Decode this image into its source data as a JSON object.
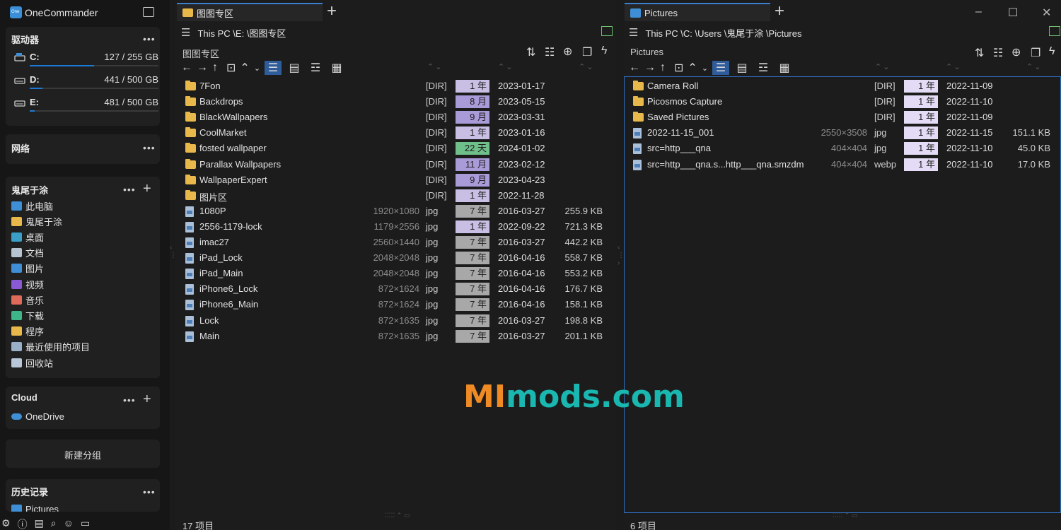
{
  "app": {
    "title": "OneCommander",
    "logo_text": "One"
  },
  "sidebar": {
    "drives_title": "驱动器",
    "drives": [
      {
        "letter": "C:",
        "size": "127 / 255 GB",
        "used_fraction": 0.5
      },
      {
        "letter": "D:",
        "size": "441 / 500 GB",
        "used_fraction": 0.1
      },
      {
        "letter": "E:",
        "size": "481 / 500 GB",
        "used_fraction": 0.04
      }
    ],
    "network_title": "网络",
    "favorites_title": "鬼尾于涂",
    "favorites": [
      {
        "label": "此电脑",
        "icon": "monitor-icon",
        "color": "#3f8fd6"
      },
      {
        "label": "鬼尾于涂",
        "icon": "folder-icon",
        "color": "#e8b94a"
      },
      {
        "label": "桌面",
        "icon": "desktop-icon",
        "color": "#3aa0c8"
      },
      {
        "label": "文档",
        "icon": "document-icon",
        "color": "#b8c4d0"
      },
      {
        "label": "图片",
        "icon": "pictures-icon",
        "color": "#3f8fd6"
      },
      {
        "label": "视频",
        "icon": "video-icon",
        "color": "#8a5ad6"
      },
      {
        "label": "音乐",
        "icon": "music-icon",
        "color": "#e06a5a"
      },
      {
        "label": "下载",
        "icon": "download-icon",
        "color": "#3fb58a"
      },
      {
        "label": "程序",
        "icon": "folder-icon",
        "color": "#e8b94a"
      },
      {
        "label": "最近使用的项目",
        "icon": "recent-icon",
        "color": "#9ab0c8"
      },
      {
        "label": "回收站",
        "icon": "recycle-bin-icon",
        "color": "#b8c8d8"
      }
    ],
    "cloud_title": "Cloud",
    "cloud_items": [
      {
        "label": "OneDrive",
        "icon": "onedrive-icon",
        "color": "#3f8fd6"
      }
    ],
    "new_group_label": "新建分组",
    "history_title": "历史记录",
    "history_items": [
      "Pictures"
    ],
    "more_glyph": "•••",
    "plus_glyph": "+"
  },
  "left_pane": {
    "tab_label": "图图专区",
    "address": "This PC \\E: \\图图专区",
    "label": "图图专区",
    "status": "17 项目",
    "rows": [
      {
        "type": "dir",
        "name": "7Fon",
        "dim": "",
        "ext": "[DIR]",
        "age": "1 年",
        "age_color": "#c9bfe4",
        "date": "2023-01-17",
        "size": ""
      },
      {
        "type": "dir",
        "name": "Backdrops",
        "dim": "",
        "ext": "[DIR]",
        "age": "8 月",
        "age_color": "#a99ad8",
        "date": "2023-05-15",
        "size": ""
      },
      {
        "type": "dir",
        "name": "BlackWallpapers",
        "dim": "",
        "ext": "[DIR]",
        "age": "9 月",
        "age_color": "#a99ad8",
        "date": "2023-03-31",
        "size": ""
      },
      {
        "type": "dir",
        "name": "CoolMarket",
        "dim": "",
        "ext": "[DIR]",
        "age": "1 年",
        "age_color": "#c9bfe4",
        "date": "2023-01-16",
        "size": ""
      },
      {
        "type": "dir",
        "name": "fosted wallpaper",
        "dim": "",
        "ext": "[DIR]",
        "age": "22 天",
        "age_color": "#6fbf8a",
        "date": "2024-01-02",
        "size": ""
      },
      {
        "type": "dir",
        "name": "Parallax Wallpapers",
        "dim": "",
        "ext": "[DIR]",
        "age": "11 月",
        "age_color": "#a99ad8",
        "date": "2023-02-12",
        "size": ""
      },
      {
        "type": "dir",
        "name": "WallpaperExpert",
        "dim": "",
        "ext": "[DIR]",
        "age": "9 月",
        "age_color": "#a99ad8",
        "date": "2023-04-23",
        "size": ""
      },
      {
        "type": "dir",
        "name": "图片区",
        "dim": "",
        "ext": "[DIR]",
        "age": "1 年",
        "age_color": "#c9bfe4",
        "date": "2022-11-28",
        "size": ""
      },
      {
        "type": "file",
        "name": "1080P",
        "dim": "1920×1080",
        "ext": "jpg",
        "age": "7 年",
        "age_color": "#a8a8a8",
        "date": "2016-03-27",
        "size": "255.9 KB"
      },
      {
        "type": "file",
        "name": "2556-1179-lock",
        "dim": "1179×2556",
        "ext": "jpg",
        "age": "1 年",
        "age_color": "#c9bfe4",
        "date": "2022-09-22",
        "size": "721.3 KB"
      },
      {
        "type": "file",
        "name": "imac27",
        "dim": "2560×1440",
        "ext": "jpg",
        "age": "7 年",
        "age_color": "#a8a8a8",
        "date": "2016-03-27",
        "size": "442.2 KB"
      },
      {
        "type": "file",
        "name": "iPad_Lock",
        "dim": "2048×2048",
        "ext": "jpg",
        "age": "7 年",
        "age_color": "#a8a8a8",
        "date": "2016-04-16",
        "size": "558.7 KB"
      },
      {
        "type": "file",
        "name": "iPad_Main",
        "dim": "2048×2048",
        "ext": "jpg",
        "age": "7 年",
        "age_color": "#a8a8a8",
        "date": "2016-04-16",
        "size": "553.2 KB"
      },
      {
        "type": "file",
        "name": "iPhone6_Lock",
        "dim": "872×1624",
        "ext": "jpg",
        "age": "7 年",
        "age_color": "#a8a8a8",
        "date": "2016-04-16",
        "size": "176.7 KB"
      },
      {
        "type": "file",
        "name": "iPhone6_Main",
        "dim": "872×1624",
        "ext": "jpg",
        "age": "7 年",
        "age_color": "#a8a8a8",
        "date": "2016-04-16",
        "size": "158.1 KB"
      },
      {
        "type": "file",
        "name": "Lock",
        "dim": "872×1635",
        "ext": "jpg",
        "age": "7 年",
        "age_color": "#a8a8a8",
        "date": "2016-03-27",
        "size": "198.8 KB"
      },
      {
        "type": "file",
        "name": "Main",
        "dim": "872×1635",
        "ext": "jpg",
        "age": "7 年",
        "age_color": "#a8a8a8",
        "date": "2016-03-27",
        "size": "201.1 KB"
      }
    ]
  },
  "right_pane": {
    "tab_label": "Pictures",
    "address": "This PC \\C: \\Users \\鬼尾于涂 \\Pictures",
    "label": "Pictures",
    "status": "6 项目",
    "rows": [
      {
        "type": "dir",
        "name": "Camera Roll",
        "dim": "",
        "ext": "[DIR]",
        "age": "1 年",
        "age_color": "#e4dcf6",
        "date": "2022-11-09",
        "size": ""
      },
      {
        "type": "dir",
        "name": "Picosmos Capture",
        "dim": "",
        "ext": "[DIR]",
        "age": "1 年",
        "age_color": "#e4dcf6",
        "date": "2022-11-10",
        "size": ""
      },
      {
        "type": "dir",
        "name": "Saved Pictures",
        "dim": "",
        "ext": "[DIR]",
        "age": "1 年",
        "age_color": "#e4dcf6",
        "date": "2022-11-09",
        "size": ""
      },
      {
        "type": "file",
        "name": "2022-11-15_001",
        "dim": "2550×3508",
        "ext": "jpg",
        "age": "1 年",
        "age_color": "#e4dcf6",
        "date": "2022-11-15",
        "size": "151.1 KB"
      },
      {
        "type": "file",
        "name": "src=http___qna",
        "dim": "404×404",
        "ext": "jpg",
        "age": "1 年",
        "age_color": "#e4dcf6",
        "date": "2022-11-10",
        "size": "45.0 KB"
      },
      {
        "type": "file",
        "name": "src=http___qna.s...http___qna.smzdm",
        "dim": "404×404",
        "ext": "webp",
        "age": "1 年",
        "age_color": "#e4dcf6",
        "date": "2022-11-10",
        "size": "17.0 KB"
      }
    ]
  },
  "watermark": {
    "part1": "MI",
    "part2": "mods.com"
  },
  "colors": {
    "accent": "#2f5c9a",
    "tab_border": "#3c7fd0",
    "drive_bar": "#1c7ad6"
  }
}
